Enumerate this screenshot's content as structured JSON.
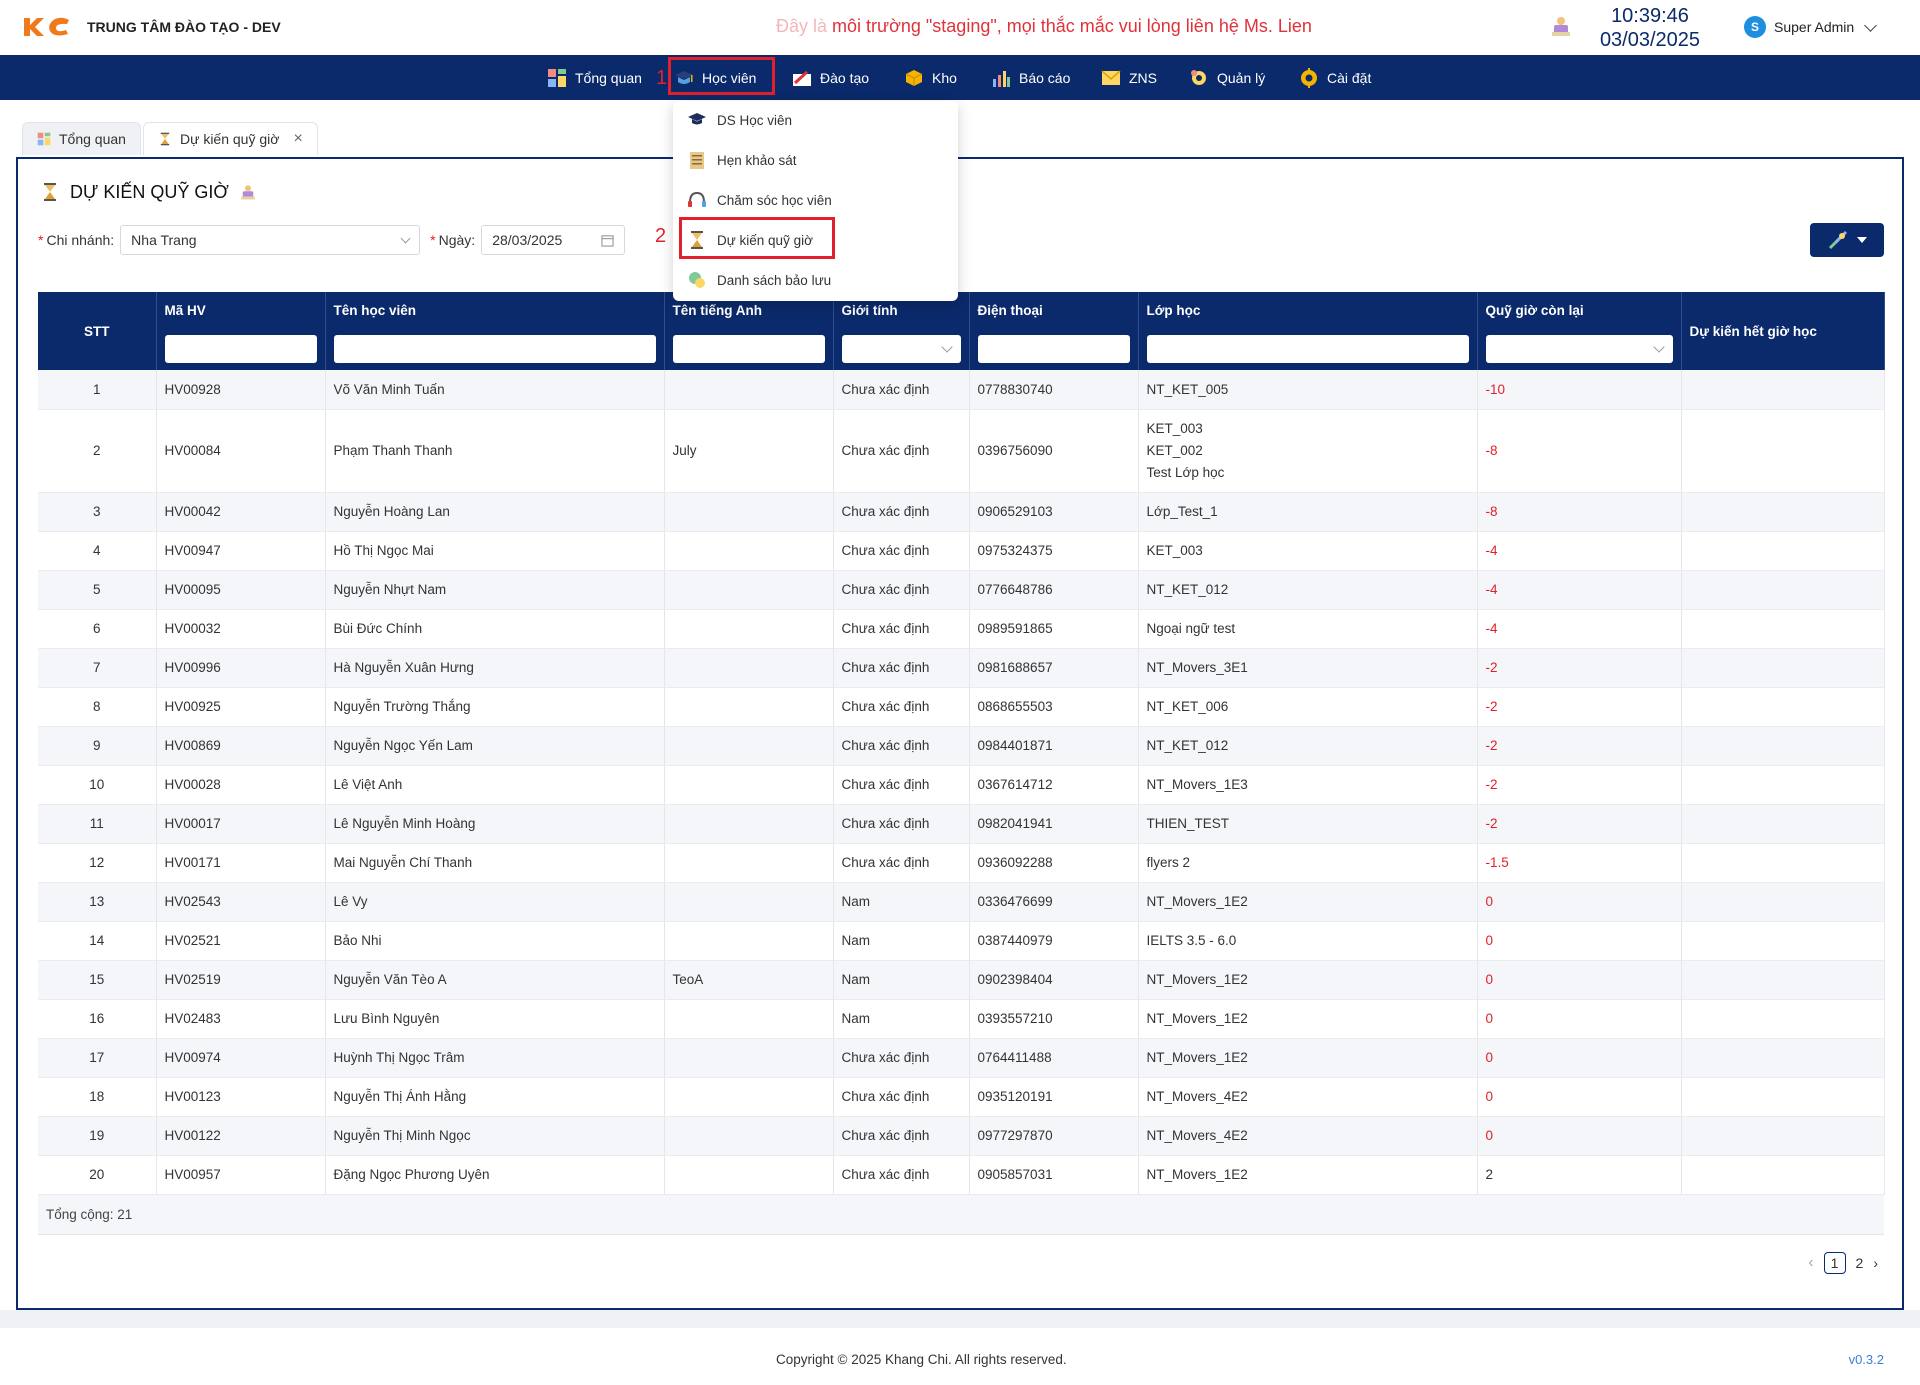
{
  "header": {
    "org_name": "TRUNG TÂM ĐÀO TẠO - DEV",
    "staging_prefix": "Đây là ",
    "staging_notice": "môi trường \"staging\", mọi thắc mắc vui lòng liên hệ Ms. Lien",
    "time": "10:39:46",
    "date": "03/03/2025",
    "user_initial": "S",
    "user_name": "Super Admin"
  },
  "nav": {
    "items": [
      "Tổng quan",
      "Học viên",
      "Đào tạo",
      "Kho",
      "Báo cáo",
      "ZNS",
      "Quản lý",
      "Cài đặt"
    ],
    "marker_1": "1",
    "marker_2": "2"
  },
  "dropdown": {
    "items": [
      "DS Học viên",
      "Hẹn khảo sát",
      "Chăm sóc học viên",
      "Dự kiến quỹ giờ",
      "Danh sách bảo lưu"
    ]
  },
  "tabs": [
    {
      "label": "Tổng quan"
    },
    {
      "label": "Dự kiến quỹ giờ",
      "close": "×"
    }
  ],
  "page": {
    "title": "DỰ KIẾN QUỸ GIỜ",
    "branch_label": "Chi nhánh:",
    "branch_value": "Nha Trang",
    "date_label": "Ngày:",
    "date_value": "28/03/2025",
    "required_mark": "*"
  },
  "table": {
    "columns": [
      "STT",
      "Mã HV",
      "Tên học viên",
      "Tên tiếng Anh",
      "Giới tính",
      "Điện thoại",
      "Lớp học",
      "Quỹ giờ còn lại",
      "Dự kiến hết giờ học"
    ],
    "rows": [
      {
        "stt": "1",
        "code": "HV00928",
        "name": "Võ Văn Minh Tuấn",
        "en": "",
        "gender": "Chưa xác định",
        "phone": "0778830740",
        "classes": [
          "NT_KET_005"
        ],
        "hours": "-10"
      },
      {
        "stt": "2",
        "code": "HV00084",
        "name": "Phạm Thanh Thanh",
        "en": "July",
        "gender": "Chưa xác định",
        "phone": "0396756090",
        "classes": [
          "KET_003",
          "KET_002",
          "Test Lớp học"
        ],
        "hours": "-8"
      },
      {
        "stt": "3",
        "code": "HV00042",
        "name": "Nguyễn Hoàng Lan",
        "en": "",
        "gender": "Chưa xác định",
        "phone": "0906529103",
        "classes": [
          "Lớp_Test_1"
        ],
        "hours": "-8"
      },
      {
        "stt": "4",
        "code": "HV00947",
        "name": "Hồ Thị Ngọc Mai",
        "en": "",
        "gender": "Chưa xác định",
        "phone": "0975324375",
        "classes": [
          "KET_003"
        ],
        "hours": "-4"
      },
      {
        "stt": "5",
        "code": "HV00095",
        "name": "Nguyễn Nhựt Nam",
        "en": "",
        "gender": "Chưa xác định",
        "phone": "0776648786",
        "classes": [
          "NT_KET_012"
        ],
        "hours": "-4"
      },
      {
        "stt": "6",
        "code": "HV00032",
        "name": "Bùi Đức Chính",
        "en": "",
        "gender": "Chưa xác định",
        "phone": "0989591865",
        "classes": [
          "Ngoại ngữ test"
        ],
        "hours": "-4"
      },
      {
        "stt": "7",
        "code": "HV00996",
        "name": "Hà Nguyễn Xuân Hưng",
        "en": "",
        "gender": "Chưa xác định",
        "phone": "0981688657",
        "classes": [
          "NT_Movers_3E1"
        ],
        "hours": "-2"
      },
      {
        "stt": "8",
        "code": "HV00925",
        "name": "Nguyễn Trường Thắng",
        "en": "",
        "gender": "Chưa xác định",
        "phone": "0868655503",
        "classes": [
          "NT_KET_006"
        ],
        "hours": "-2"
      },
      {
        "stt": "9",
        "code": "HV00869",
        "name": "Nguyễn Ngọc Yến Lam",
        "en": "",
        "gender": "Chưa xác định",
        "phone": "0984401871",
        "classes": [
          "NT_KET_012"
        ],
        "hours": "-2"
      },
      {
        "stt": "10",
        "code": "HV00028",
        "name": "Lê Việt Anh",
        "en": "",
        "gender": "Chưa xác định",
        "phone": "0367614712",
        "classes": [
          "NT_Movers_1E3"
        ],
        "hours": "-2"
      },
      {
        "stt": "11",
        "code": "HV00017",
        "name": "Lê Nguyễn Minh Hoàng",
        "en": "",
        "gender": "Chưa xác định",
        "phone": "0982041941",
        "classes": [
          "THIEN_TEST"
        ],
        "hours": "-2"
      },
      {
        "stt": "12",
        "code": "HV00171",
        "name": "Mai Nguyễn Chí Thanh",
        "en": "",
        "gender": "Chưa xác định",
        "phone": "0936092288",
        "classes": [
          "flyers 2"
        ],
        "hours": "-1.5"
      },
      {
        "stt": "13",
        "code": "HV02543",
        "name": "Lê Vy",
        "en": "",
        "gender": "Nam",
        "phone": "0336476699",
        "classes": [
          "NT_Movers_1E2"
        ],
        "hours": "0"
      },
      {
        "stt": "14",
        "code": "HV02521",
        "name": "Bảo Nhi",
        "en": "",
        "gender": "Nam",
        "phone": "0387440979",
        "classes": [
          "IELTS 3.5 - 6.0"
        ],
        "hours": "0"
      },
      {
        "stt": "15",
        "code": "HV02519",
        "name": "Nguyễn Văn Tèo A",
        "en": "TeoA",
        "gender": "Nam",
        "phone": "0902398404",
        "classes": [
          "NT_Movers_1E2"
        ],
        "hours": "0"
      },
      {
        "stt": "16",
        "code": "HV02483",
        "name": "Lưu Bình Nguyên",
        "en": "",
        "gender": "Nam",
        "phone": "0393557210",
        "classes": [
          "NT_Movers_1E2"
        ],
        "hours": "0"
      },
      {
        "stt": "17",
        "code": "HV00974",
        "name": "Huỳnh Thị Ngọc Trâm",
        "en": "",
        "gender": "Chưa xác định",
        "phone": "0764411488",
        "classes": [
          "NT_Movers_1E2"
        ],
        "hours": "0"
      },
      {
        "stt": "18",
        "code": "HV00123",
        "name": "Nguyễn Thị Ánh Hằng",
        "en": "",
        "gender": "Chưa xác định",
        "phone": "0935120191",
        "classes": [
          "NT_Movers_4E2"
        ],
        "hours": "0"
      },
      {
        "stt": "19",
        "code": "HV00122",
        "name": "Nguyễn Thị Minh Ngọc",
        "en": "",
        "gender": "Chưa xác định",
        "phone": "0977297870",
        "classes": [
          "NT_Movers_4E2"
        ],
        "hours": "0"
      },
      {
        "stt": "20",
        "code": "HV00957",
        "name": "Đặng Ngọc Phương Uyên",
        "en": "",
        "gender": "Chưa xác định",
        "phone": "0905857031",
        "classes": [
          "NT_Movers_1E2"
        ],
        "hours": "2"
      }
    ],
    "total": "Tổng cộng: 21"
  },
  "pagination": {
    "prev": "‹",
    "current": "1",
    "next_page": "2",
    "next": "›"
  },
  "footer": {
    "copyright": "Copyright © 2025 Khang Chi. All rights reserved.",
    "version": "v0.3.2"
  },
  "colors": {
    "brand_navy": "#0b2a6b",
    "highlight_red": "#e0202a",
    "logo_orange": "#f07a1a"
  }
}
